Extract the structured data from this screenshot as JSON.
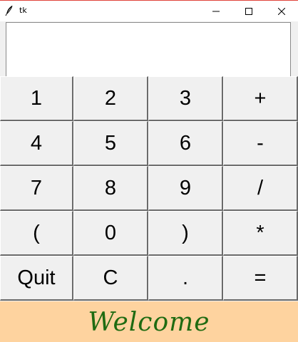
{
  "window": {
    "title": "tk",
    "controls": {
      "minimize_icon": "minimize-icon",
      "maximize_icon": "maximize-icon",
      "close_icon": "close-icon"
    }
  },
  "display": {
    "value": ""
  },
  "keys": [
    {
      "label": "1",
      "name": "key-1"
    },
    {
      "label": "2",
      "name": "key-2"
    },
    {
      "label": "3",
      "name": "key-3"
    },
    {
      "label": "+",
      "name": "key-plus"
    },
    {
      "label": "4",
      "name": "key-4"
    },
    {
      "label": "5",
      "name": "key-5"
    },
    {
      "label": "6",
      "name": "key-6"
    },
    {
      "label": "-",
      "name": "key-minus"
    },
    {
      "label": "7",
      "name": "key-7"
    },
    {
      "label": "8",
      "name": "key-8"
    },
    {
      "label": "9",
      "name": "key-9"
    },
    {
      "label": "/",
      "name": "key-divide"
    },
    {
      "label": "(",
      "name": "key-open-paren"
    },
    {
      "label": "0",
      "name": "key-0"
    },
    {
      "label": ")",
      "name": "key-close-paren"
    },
    {
      "label": "*",
      "name": "key-multiply"
    },
    {
      "label": "Quit",
      "name": "quit-button"
    },
    {
      "label": "C",
      "name": "clear-button"
    },
    {
      "label": ".",
      "name": "key-decimal"
    },
    {
      "label": "=",
      "name": "equals-button"
    }
  ],
  "status": {
    "message": "Welcome"
  },
  "colors": {
    "status_background": "#fed39f",
    "status_text": "#1f6b12",
    "window_background": "#f0f0f0"
  }
}
